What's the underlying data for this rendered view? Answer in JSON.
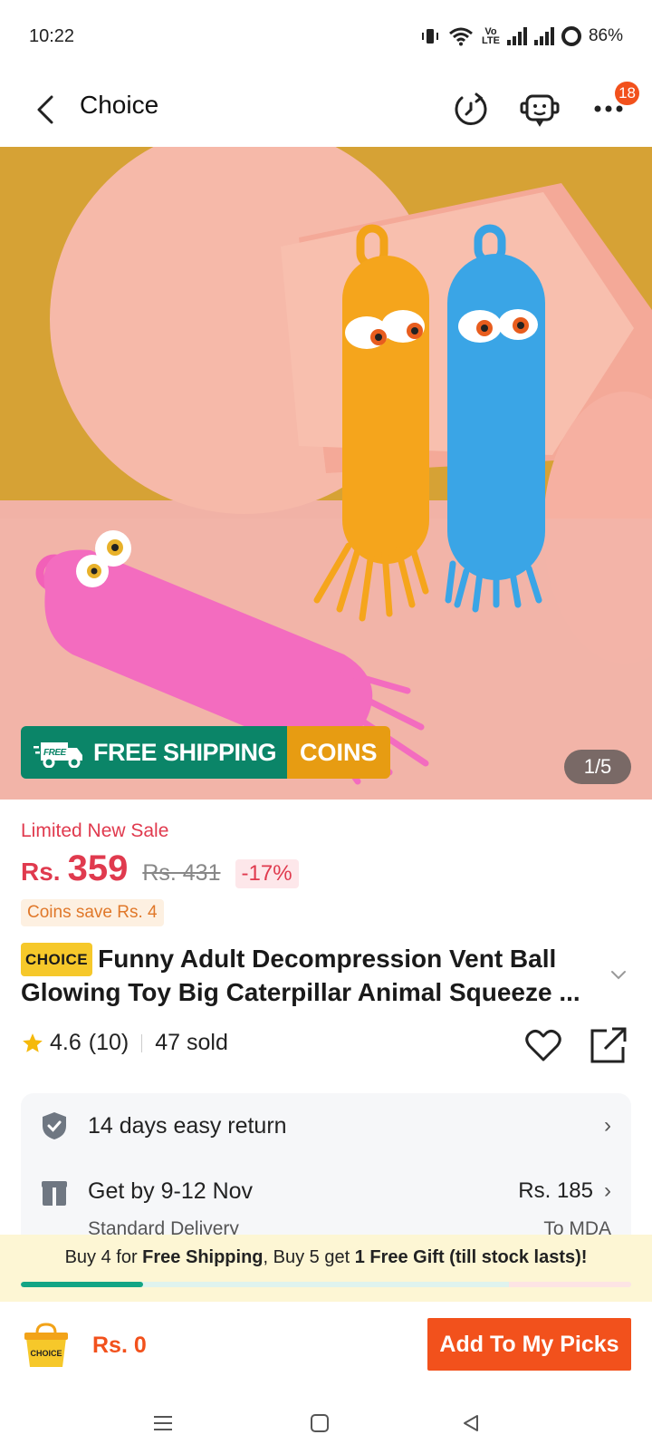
{
  "status_bar": {
    "time": "10:22",
    "volte": "Vo\nLTE",
    "battery": "86%"
  },
  "header": {
    "title": "Choice",
    "notification_count": "18",
    "icons": [
      "back-arrow-icon",
      "history-icon",
      "support-bot-icon",
      "more-icon"
    ]
  },
  "gallery": {
    "free_shipping_label": "FREE SHIPPING",
    "free_tag": "FREE",
    "coins_label": "COINS",
    "counter": "1/5",
    "image_description": "three caterpillar squeeze toys: yellow, blue, pink"
  },
  "price": {
    "sale_label": "Limited New Sale",
    "currency": "Rs.",
    "current": "359",
    "original": "Rs. 431",
    "discount": "-17%",
    "coins_save": "Coins save Rs. 4"
  },
  "product": {
    "choice_tag": "CHOICE",
    "title": "Funny Adult Decompression Vent Ball Glowing Toy Big Caterpillar Animal Squeeze ..."
  },
  "rating": {
    "score": "4.6",
    "count": "(10)",
    "sold": "47 sold"
  },
  "services": {
    "return_text": "14 days easy return",
    "delivery_text": "Get by 9-12 Nov",
    "delivery_sub": "Standard Delivery",
    "delivery_price": "Rs. 185",
    "delivery_to": "To MDA"
  },
  "bundle": {
    "part1": "Buy 4 for ",
    "part2": "Free Shipping",
    "part3": ", Buy 5 get ",
    "part4": "1 Free Gift (till stock lasts)!",
    "progress_fraction": 0.2
  },
  "action_bar": {
    "cart_label": "CHOICE",
    "total": "Rs. 0",
    "add_button": "Add To My Picks"
  },
  "colors": {
    "accent": "#f2511c",
    "price_red": "#e03a4e",
    "free_shipping_green": "#0b8568",
    "coins_orange": "#e79c12"
  }
}
